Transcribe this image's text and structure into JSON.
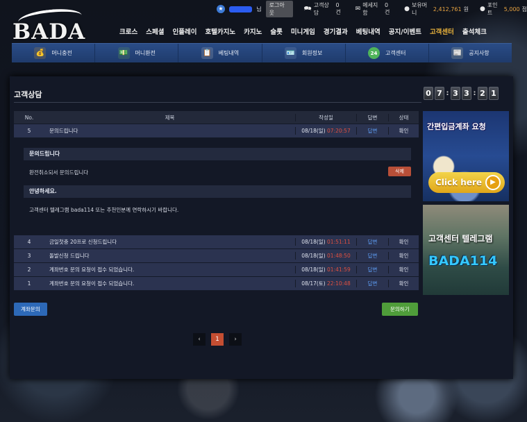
{
  "site": {
    "logo_text": "BADA"
  },
  "userbar": {
    "suffix": "님",
    "logout": "로그아웃",
    "consult_label": "고객상담",
    "consult_count": "0건",
    "message_label": "메세지함",
    "message_count": "0건",
    "money_label": "보유머니",
    "money_value": "2,412,761",
    "money_unit": "원",
    "point_label": "포인트",
    "point_value": "5,000",
    "point_unit": "점"
  },
  "mainnav": [
    "크로스",
    "스페셜",
    "인플레이",
    "호텔카지노",
    "카지노",
    "슬롯",
    "미니게임",
    "경기결과",
    "베팅내역",
    "공지/이벤트",
    "고객센터",
    "출석체크"
  ],
  "subnav": [
    {
      "label": "머니충전",
      "icon": "money-bag-icon",
      "color": "#d79b2b",
      "glyph": "💰"
    },
    {
      "label": "머니환전",
      "icon": "money-exchange-icon",
      "color": "#6aa84f",
      "glyph": "💵"
    },
    {
      "label": "베팅내역",
      "icon": "clipboard-icon",
      "color": "#c9c9c9",
      "glyph": "📋"
    },
    {
      "label": "회원정보",
      "icon": "member-card-icon",
      "color": "#8ba3c7",
      "glyph": "🪪"
    },
    {
      "label": "고객센터",
      "icon": "support-24-icon",
      "color": "#4fb45a",
      "glyph": "24"
    },
    {
      "label": "공지사항",
      "icon": "notice-board-icon",
      "color": "#d9d4a6",
      "glyph": "📰"
    }
  ],
  "page": {
    "title": "고객상담"
  },
  "clock": {
    "h1": "0",
    "h2": "7",
    "m1": "3",
    "m2": "3",
    "s1": "2",
    "s2": "1"
  },
  "table": {
    "headers": {
      "no": "No.",
      "title": "제목",
      "date": "작성일",
      "answer": "답변",
      "status": "상태"
    },
    "open_row": {
      "no": "5",
      "title": "문의드립니다",
      "date": "08/18(일)",
      "time": "07:20:57",
      "answer": "답변",
      "status": "확인"
    },
    "rows": [
      {
        "no": "4",
        "title": "금일첫충 20프로 신청드립니다",
        "date": "08/18(일)",
        "time": "01:51:11",
        "answer": "답변",
        "status": "확인"
      },
      {
        "no": "3",
        "title": "돌발신청 드립니다",
        "date": "08/18(일)",
        "time": "01:48:50",
        "answer": "답변",
        "status": "확인"
      },
      {
        "no": "2",
        "title": "계좌번호 문의 요청이 접수 되었습니다.",
        "date": "08/18(일)",
        "time": "01:41:59",
        "answer": "답변",
        "status": "확인"
      },
      {
        "no": "1",
        "title": "계좌번호 문의 요청이 접수 되었습니다.",
        "date": "08/17(토)",
        "time": "22:10:48",
        "answer": "답변",
        "status": "확인"
      }
    ]
  },
  "detail": {
    "question_title": "문의드립니다",
    "question_body": "환전취소되서 문의드립니다",
    "delete_label": "삭제",
    "answer_title": "안녕하세요.",
    "answer_body": "고객센터 텔레그램 bada114 또는 추천인분께 연락하시기 바랍니다."
  },
  "buttons": {
    "account_inquiry": "계좌문의",
    "inquire": "문의하기"
  },
  "pager": {
    "prev": "‹",
    "current": "1",
    "next": "›"
  },
  "banner1": {
    "title": "간편입금계좌 요청",
    "cta": "Click here"
  },
  "banner2": {
    "line1": "고객센터 텔레그램",
    "line2": "BADA114"
  }
}
